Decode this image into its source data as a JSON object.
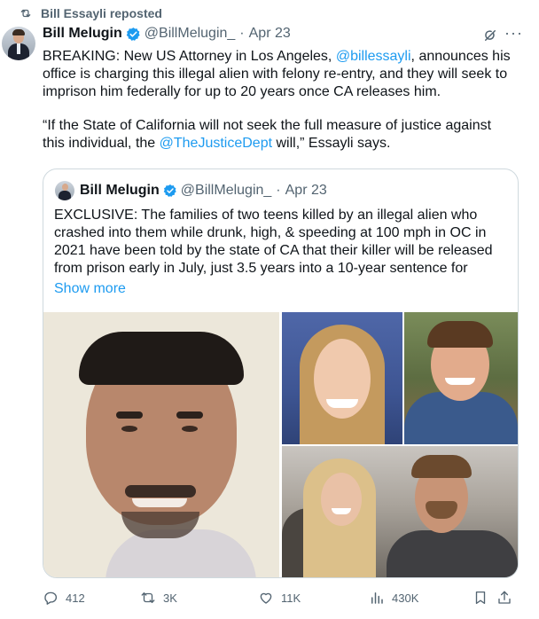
{
  "repost": {
    "label": "Bill Essayli reposted"
  },
  "tweet": {
    "author_name": "Bill Melugin",
    "author_handle": "@BillMelugin_",
    "separator": "·",
    "date": "Apr 23",
    "more_label": "···",
    "paragraph1": {
      "part1": "BREAKING: New US Attorney in Los Angeles, ",
      "mention": "@billessayli",
      "part2": ", announces his office is charging this illegal alien with felony re-entry, and they will seek to imprison him federally for up to 20 years once CA releases him."
    },
    "paragraph2": {
      "part1": "“If the State of California will not seek the full measure of justice against this individual, the ",
      "mention": "@TheJusticeDept",
      "part2": " will,” Essayli says."
    }
  },
  "quote": {
    "author_name": "Bill Melugin",
    "author_handle": "@BillMelugin_",
    "separator": "·",
    "date": "Apr 23",
    "text": "EXCLUSIVE: The families of two teens killed by an illegal alien who crashed into them while drunk, high, & speeding at 100 mph in OC in 2021 have been told by the state of CA that their killer will be released from prison early in July, just 3.5 years into a 10-year sentence for",
    "show_more": "Show more"
  },
  "actions": {
    "replies": "412",
    "reposts": "3K",
    "likes": "11K",
    "views": "430K"
  },
  "colors": {
    "accent": "#1d9bf0",
    "muted": "#536471",
    "repost_green": "#536471"
  },
  "icons": [
    "repost-icon",
    "verified-badge-icon",
    "grok-icon",
    "more-icon",
    "reply-icon",
    "retweet-icon",
    "like-icon",
    "views-icon",
    "bookmark-icon",
    "share-icon"
  ]
}
